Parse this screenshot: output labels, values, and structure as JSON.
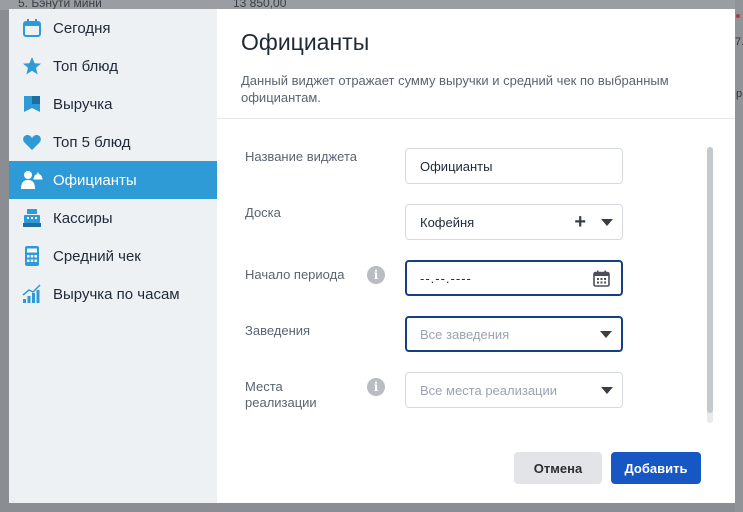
{
  "background": {
    "left_text": "5. Бэнути мини",
    "amount_text": "13 850,00",
    "right_text_1": "7.",
    "right_text_2": "р"
  },
  "sidebar": {
    "items": [
      {
        "label": "Сегодня",
        "icon": "calendar-icon",
        "active": false
      },
      {
        "label": "Топ блюд",
        "icon": "star-icon",
        "active": false
      },
      {
        "label": "Выручка",
        "icon": "revenue-icon",
        "active": false
      },
      {
        "label": "Топ 5 блюд",
        "icon": "heart-icon",
        "active": false
      },
      {
        "label": "Официанты",
        "icon": "waiter-icon",
        "active": true
      },
      {
        "label": "Кассиры",
        "icon": "cash-register-icon",
        "active": false
      },
      {
        "label": "Средний чек",
        "icon": "calculator-icon",
        "active": false
      },
      {
        "label": "Выручка по часам",
        "icon": "bar-chart-icon",
        "active": false
      }
    ]
  },
  "main": {
    "title": "Официанты",
    "description": "Данный виджет отражает сумму выручки и средний чек по выбранным официантам."
  },
  "form": {
    "widget_name": {
      "label": "Название виджета",
      "value": "Официанты"
    },
    "board": {
      "label": "Доска",
      "value": "Кофейня"
    },
    "period_start": {
      "label": "Начало периода",
      "value": "--.--.----"
    },
    "venues": {
      "label": "Заведения",
      "placeholder": "Все заведения"
    },
    "sale_points": {
      "label": "Места реализации",
      "placeholder": "Все места реализации"
    }
  },
  "buttons": {
    "cancel": "Отмена",
    "add": "Добавить"
  },
  "colors": {
    "accent": "#2e9bd6",
    "primary_button": "#1657c4",
    "focus_border": "#163f82",
    "sidebar_bg": "#eef1f4"
  }
}
